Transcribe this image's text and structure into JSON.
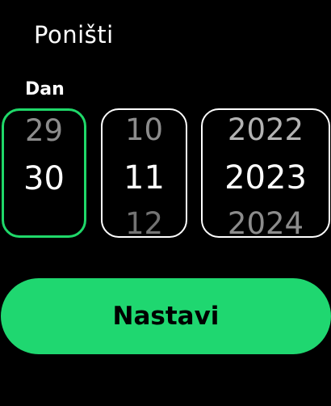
{
  "header": {
    "cancel_label": "Poništi"
  },
  "picker": {
    "field_label": "Dan",
    "day": {
      "prev": "29",
      "current": "30",
      "next": ""
    },
    "month": {
      "prev": "10",
      "current": "11",
      "next": "12"
    },
    "year": {
      "prev": "2022",
      "current": "2023",
      "next": "2024"
    }
  },
  "footer": {
    "confirm_label": "Nastavi"
  },
  "colors": {
    "accent": "#1fd770",
    "selected_border": "#1fd869",
    "background": "#000000"
  }
}
